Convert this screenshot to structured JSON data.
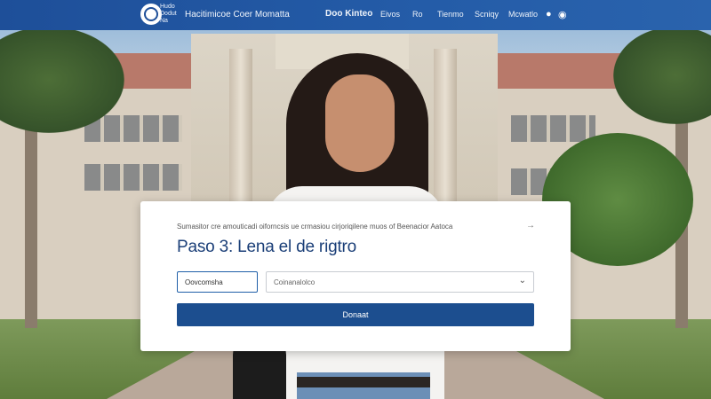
{
  "navbar": {
    "logo_text": "Hudo Dodut Na",
    "site_name": "Hacitimicoe Coer Momatta",
    "items": [
      {
        "label": "Doo Kinteo",
        "active": true
      },
      {
        "label": "Eivos"
      },
      {
        "label": "Ro"
      },
      {
        "label": "Tienmo"
      },
      {
        "label": "Scniqy"
      },
      {
        "label": "Mcwatlo"
      }
    ],
    "icons": [
      "info-icon",
      "globe-icon"
    ]
  },
  "form": {
    "description": "Sumasitor cre amouticadi oiforncsis ue crmasiou cirjoriqilene muos of Beenacior Aatoca",
    "arrow_glyph": "→",
    "title": "Paso 3: Lena el de rigtro",
    "field_small_value": "Oovcomsha",
    "select_value": "Coinanalolco",
    "chevron_glyph": "⌄",
    "submit_label": "Donaat"
  },
  "colors": {
    "navbar": "#245ca8",
    "title": "#1b3f78",
    "button": "#1c4e8f",
    "input_border_active": "#1f5fa8"
  }
}
